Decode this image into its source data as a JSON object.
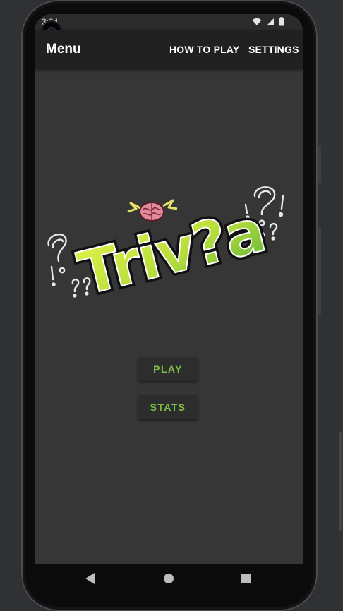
{
  "status_bar": {
    "time": "3:24",
    "icons": [
      "wifi-icon",
      "cell-signal-icon",
      "battery-icon"
    ]
  },
  "app_bar": {
    "title": "Menu",
    "actions": [
      {
        "label": "HOW TO PLAY"
      },
      {
        "label": "SETTINGS"
      }
    ]
  },
  "logo": {
    "text": "Triv?a",
    "icons": [
      "brain-icon",
      "question-mark-doodles"
    ]
  },
  "buttons": {
    "play": "PLAY",
    "stats": "STATS"
  },
  "nav_bar": {
    "icons": [
      "back-icon",
      "home-icon",
      "recents-icon"
    ]
  },
  "colors": {
    "screen_bg": "#363636",
    "app_bar_bg": "#212121",
    "button_bg": "#2d2d2d",
    "accent_green": "#7cc142",
    "logo_green": "#b8de3c",
    "brain_pink": "#e08a9a"
  }
}
